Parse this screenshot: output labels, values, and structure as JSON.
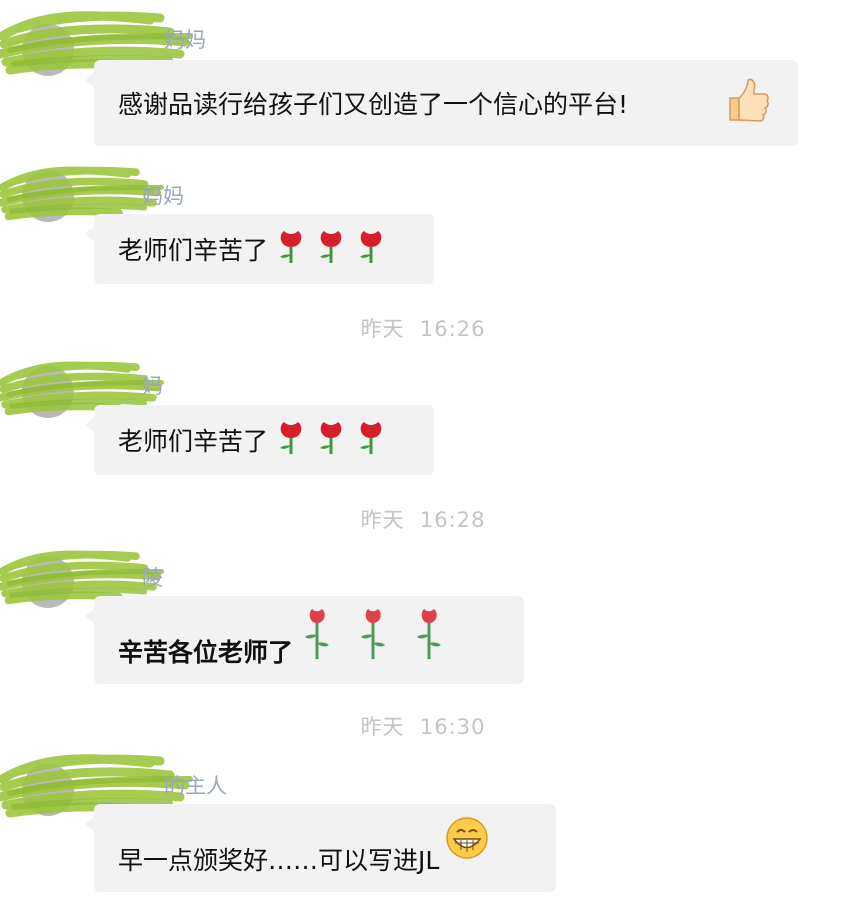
{
  "messages": [
    {
      "sender": "妈妈",
      "text": "感谢品读行给孩子们又创造了一个信心的平台!",
      "emoji": "thumbs-up-icon"
    },
    {
      "sender": "妈妈",
      "text": "老师们辛苦了",
      "emoji": "rose-icon"
    },
    {
      "sender": "妈",
      "text": "老师们辛苦了",
      "emoji": "rose-icon"
    },
    {
      "sender": "陵",
      "text": "辛苦各位老师了",
      "emoji": "rose-stem-icon"
    },
    {
      "sender": "的主人",
      "text": "早一点颁奖好……可以写进JL",
      "emoji": "grinning-face-icon"
    }
  ],
  "timestamps": [
    {
      "day": "昨天",
      "time": "16:26"
    },
    {
      "day": "昨天",
      "time": "16:28"
    },
    {
      "day": "昨天",
      "time": "16:30"
    }
  ],
  "colors": {
    "background": "#ffffff",
    "bubble": "#f2f2f2",
    "sender_name": "#9aa6bd",
    "timestamp": "#c4c4c4",
    "redaction": "#9bc53d"
  }
}
